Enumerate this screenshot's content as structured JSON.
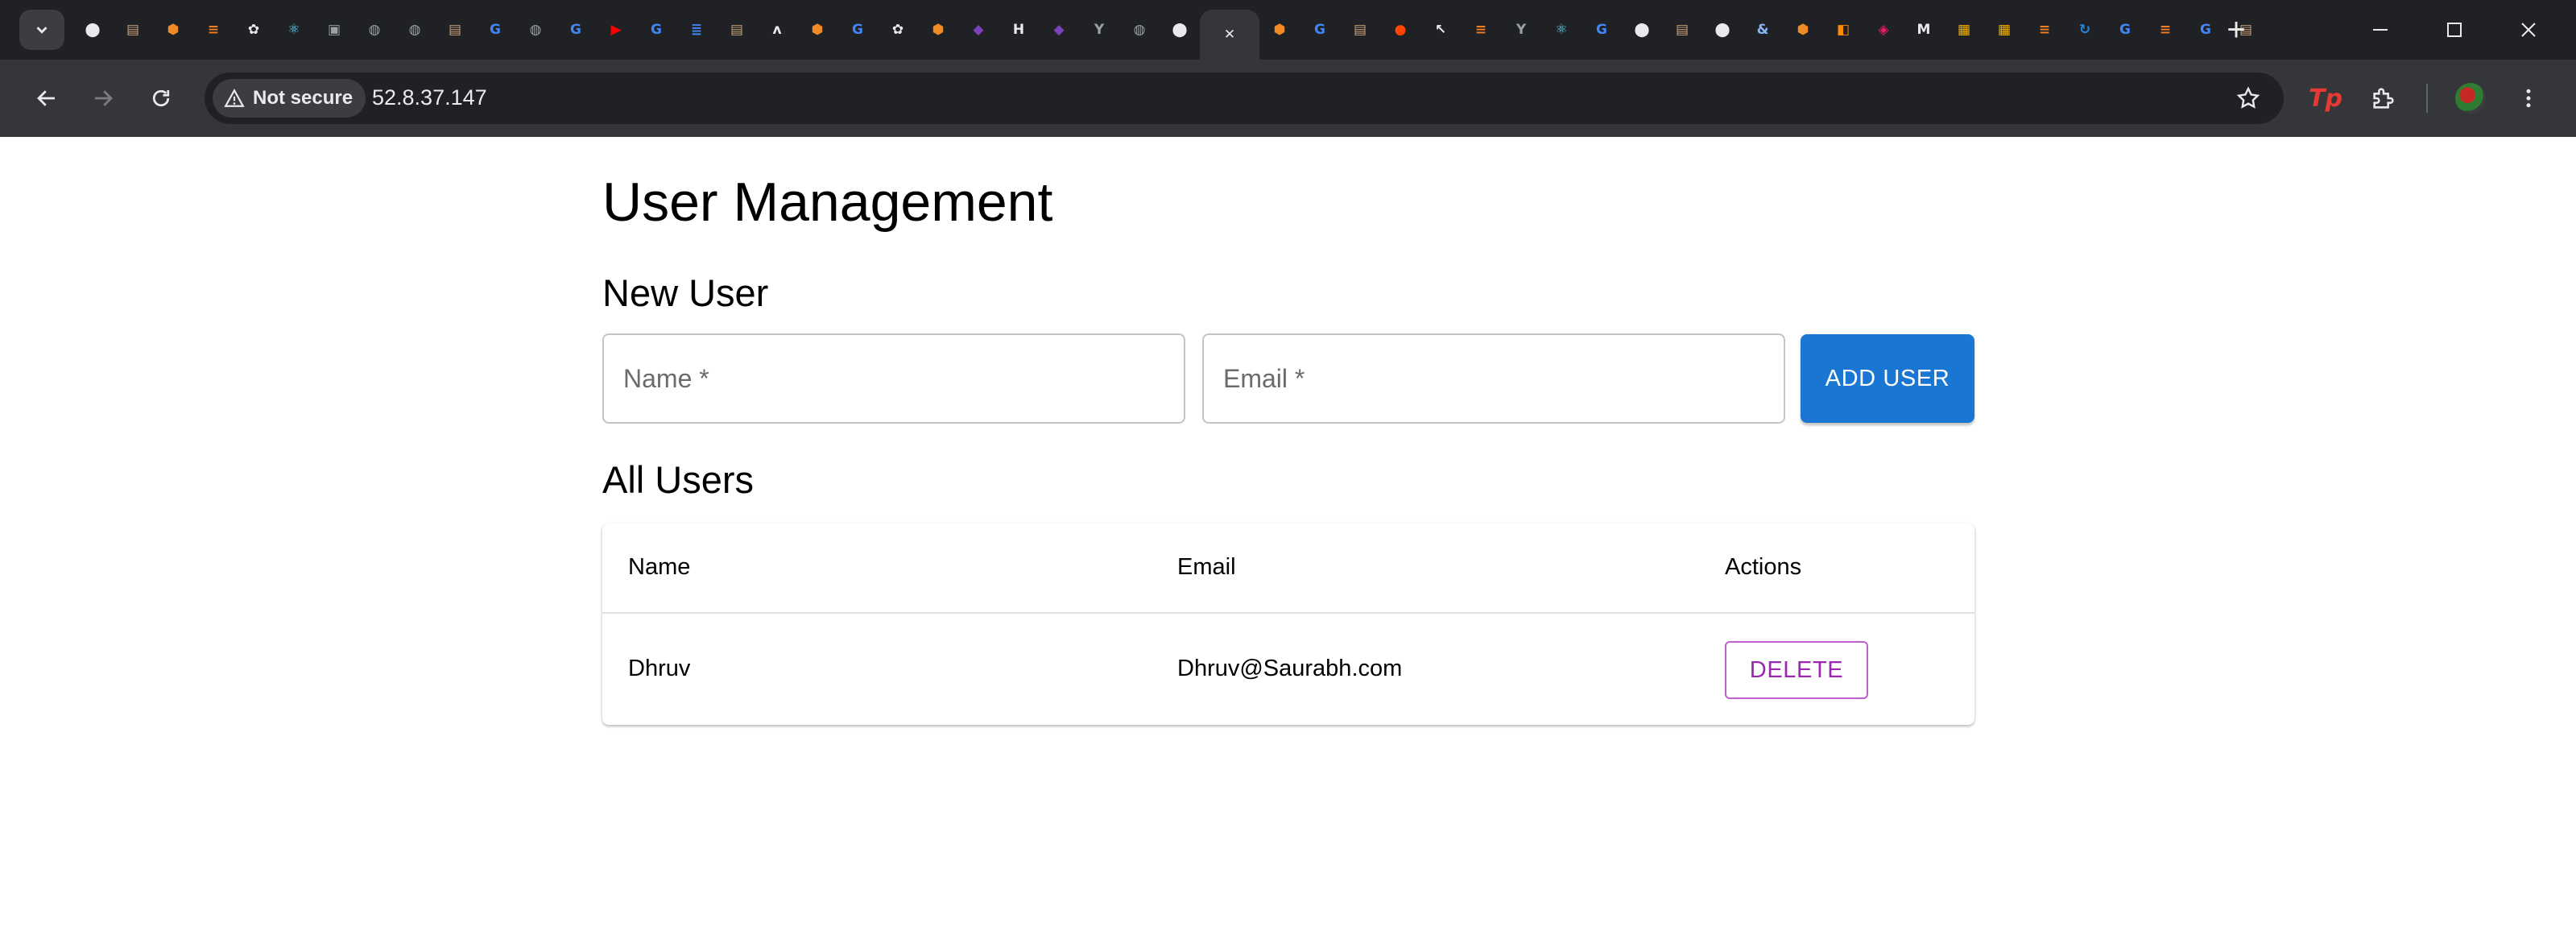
{
  "browser": {
    "address": {
      "security_label": "Not secure",
      "url": "52.8.37.147"
    },
    "tabs": [
      {
        "icon": "github-icon",
        "glyph": "⬤",
        "color": "#e8eaed",
        "round": true
      },
      {
        "icon": "book-icon",
        "glyph": "▤",
        "color": "#c8a27a"
      },
      {
        "icon": "box-icon",
        "glyph": "⬢",
        "color": "#f08a24"
      },
      {
        "icon": "stackoverflow-icon",
        "glyph": "≡",
        "color": "#f48024"
      },
      {
        "icon": "openai-icon",
        "glyph": "✿",
        "color": "#e8eaed"
      },
      {
        "icon": "react-icon",
        "glyph": "⚛",
        "color": "#61dafb"
      },
      {
        "icon": "app-icon",
        "glyph": "▣",
        "color": "#9aa0a6"
      },
      {
        "icon": "globe-icon",
        "glyph": "◍",
        "color": "#9aa0a6",
        "round": true
      },
      {
        "icon": "globe-icon",
        "glyph": "◍",
        "color": "#9aa0a6",
        "round": true
      },
      {
        "icon": "book-icon",
        "glyph": "▤",
        "color": "#c8a27a"
      },
      {
        "icon": "google-icon",
        "glyph": "G",
        "color": "#4285f4",
        "round": true
      },
      {
        "icon": "globe-icon",
        "glyph": "◍",
        "color": "#9aa0a6",
        "round": true
      },
      {
        "icon": "google-icon",
        "glyph": "G",
        "color": "#4285f4",
        "round": true
      },
      {
        "icon": "youtube-icon",
        "glyph": "▶",
        "color": "#ff0000"
      },
      {
        "icon": "google-icon",
        "glyph": "G",
        "color": "#4285f4",
        "round": true
      },
      {
        "icon": "docs-icon",
        "glyph": "≣",
        "color": "#4285f4"
      },
      {
        "icon": "book-icon",
        "glyph": "▤",
        "color": "#c8a27a"
      },
      {
        "icon": "atlassian-icon",
        "glyph": "ʌ",
        "color": "#e8eaed"
      },
      {
        "icon": "box-icon",
        "glyph": "⬢",
        "color": "#f08a24"
      },
      {
        "icon": "google-icon",
        "glyph": "G",
        "color": "#4285f4",
        "round": true
      },
      {
        "icon": "openai-icon",
        "glyph": "✿",
        "color": "#e8eaed"
      },
      {
        "icon": "box-icon",
        "glyph": "⬢",
        "color": "#f08a24"
      },
      {
        "icon": "terraform-icon",
        "glyph": "◆",
        "color": "#7b42bc"
      },
      {
        "icon": "hashicorp-icon",
        "glyph": "H",
        "color": "#e8eaed"
      },
      {
        "icon": "terraform-icon",
        "glyph": "◆",
        "color": "#7b42bc"
      },
      {
        "icon": "fork-icon",
        "glyph": "Y",
        "color": "#9aa0a6"
      },
      {
        "icon": "globe-icon",
        "glyph": "◍",
        "color": "#9aa0a6",
        "round": true
      },
      {
        "icon": "github-icon",
        "glyph": "⬤",
        "color": "#e8eaed",
        "round": true
      },
      {
        "icon": "close-icon",
        "glyph": "✕",
        "color": "#e8eaed",
        "active": true
      },
      {
        "icon": "box-icon",
        "glyph": "⬢",
        "color": "#f08a24"
      },
      {
        "icon": "google-icon",
        "glyph": "G",
        "color": "#4285f4",
        "round": true
      },
      {
        "icon": "book-icon",
        "glyph": "▤",
        "color": "#c8a27a"
      },
      {
        "icon": "reddit-icon",
        "glyph": "●",
        "color": "#ff4500",
        "round": true
      },
      {
        "icon": "cursor-icon",
        "glyph": "↖",
        "color": "#e8eaed"
      },
      {
        "icon": "stackoverflow-icon",
        "glyph": "≡",
        "color": "#f48024"
      },
      {
        "icon": "fork-icon",
        "glyph": "Y",
        "color": "#9aa0a6"
      },
      {
        "icon": "react-icon",
        "glyph": "⚛",
        "color": "#61dafb"
      },
      {
        "icon": "google-icon",
        "glyph": "G",
        "color": "#4285f4",
        "round": true
      },
      {
        "icon": "github-icon",
        "glyph": "⬤",
        "color": "#e8eaed",
        "round": true
      },
      {
        "icon": "book-icon",
        "glyph": "▤",
        "color": "#c8a27a"
      },
      {
        "icon": "github-icon",
        "glyph": "⬤",
        "color": "#e8eaed",
        "round": true
      },
      {
        "icon": "ampersand-icon",
        "glyph": "&",
        "color": "#8ab4f8"
      },
      {
        "icon": "box-icon",
        "glyph": "⬢",
        "color": "#f08a24"
      },
      {
        "icon": "orange-square-icon",
        "glyph": "◧",
        "color": "#ff8a00"
      },
      {
        "icon": "pink-square-icon",
        "glyph": "◈",
        "color": "#e91e63"
      },
      {
        "icon": "medium-icon",
        "glyph": "M",
        "color": "#e8eaed"
      },
      {
        "icon": "notebook-icon",
        "glyph": "▦",
        "color": "#f4b400"
      },
      {
        "icon": "notebook-icon",
        "glyph": "▦",
        "color": "#f4b400"
      },
      {
        "icon": "stackoverflow-icon",
        "glyph": "≡",
        "color": "#f48024"
      },
      {
        "icon": "refresh-circle-icon",
        "glyph": "↻",
        "color": "#1e88e5"
      },
      {
        "icon": "google-icon",
        "glyph": "G",
        "color": "#4285f4",
        "round": true
      },
      {
        "icon": "stackoverflow-icon",
        "glyph": "≡",
        "color": "#f48024"
      },
      {
        "icon": "google-icon",
        "glyph": "G",
        "color": "#4285f4",
        "round": true
      },
      {
        "icon": "book-icon",
        "glyph": "▤",
        "color": "#c8a27a"
      }
    ],
    "colors": {
      "chrome_dark": "#202124",
      "toolbar": "#35363a",
      "tp_extension": "#e53935"
    }
  },
  "page": {
    "title": "User Management",
    "new_user": {
      "heading": "New User",
      "name_placeholder": "Name *",
      "email_placeholder": "Email *",
      "add_label": "ADD USER"
    },
    "all_users": {
      "heading": "All Users",
      "columns": [
        "Name",
        "Email",
        "Actions"
      ],
      "rows": [
        {
          "name": "Dhruv",
          "email": "Dhruv@Saurabh.com",
          "action_label": "DELETE"
        }
      ]
    },
    "colors": {
      "primary": "#1976d2",
      "secondary": "#9c27b0"
    }
  }
}
